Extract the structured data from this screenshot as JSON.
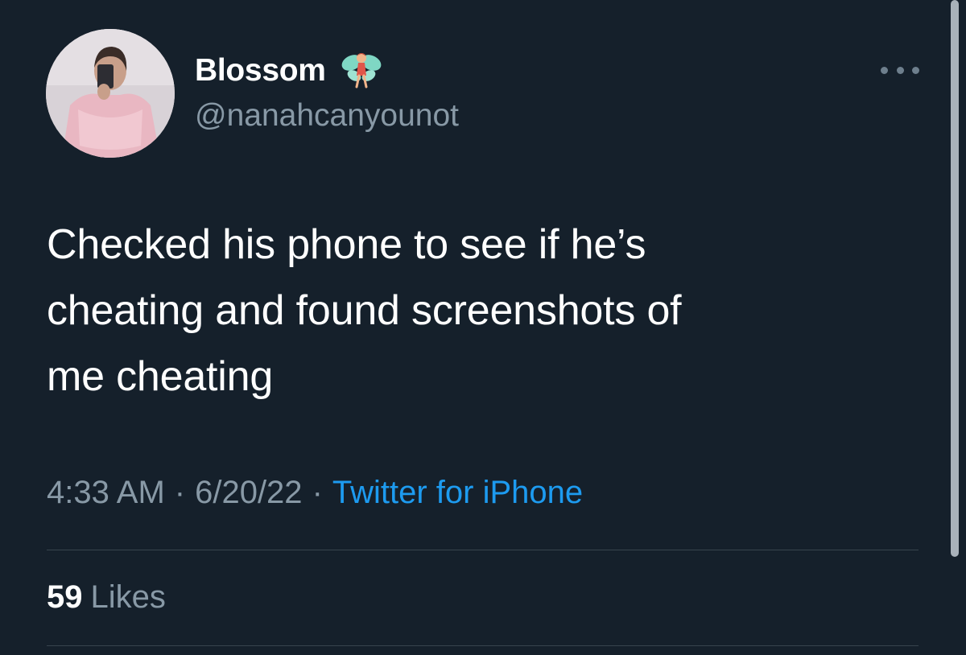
{
  "user": {
    "display_name": "Blossom",
    "handle": "@nanahcanyounot",
    "name_emoji": "fairy-icon"
  },
  "tweet": {
    "text": "Checked his phone to see if he’s\ncheating and found screenshots of\nme cheating",
    "time": "4:33 AM",
    "date": "6/20/22",
    "source": "Twitter for iPhone",
    "separator": "·"
  },
  "stats": {
    "likes_count": "59",
    "likes_label": "Likes"
  },
  "icons": {
    "more": "more-options-icon"
  },
  "colors": {
    "background": "#15202b",
    "primary_text": "#ffffff",
    "secondary_text": "#8899a6",
    "link": "#1d9bf0",
    "divider": "#38444d"
  }
}
